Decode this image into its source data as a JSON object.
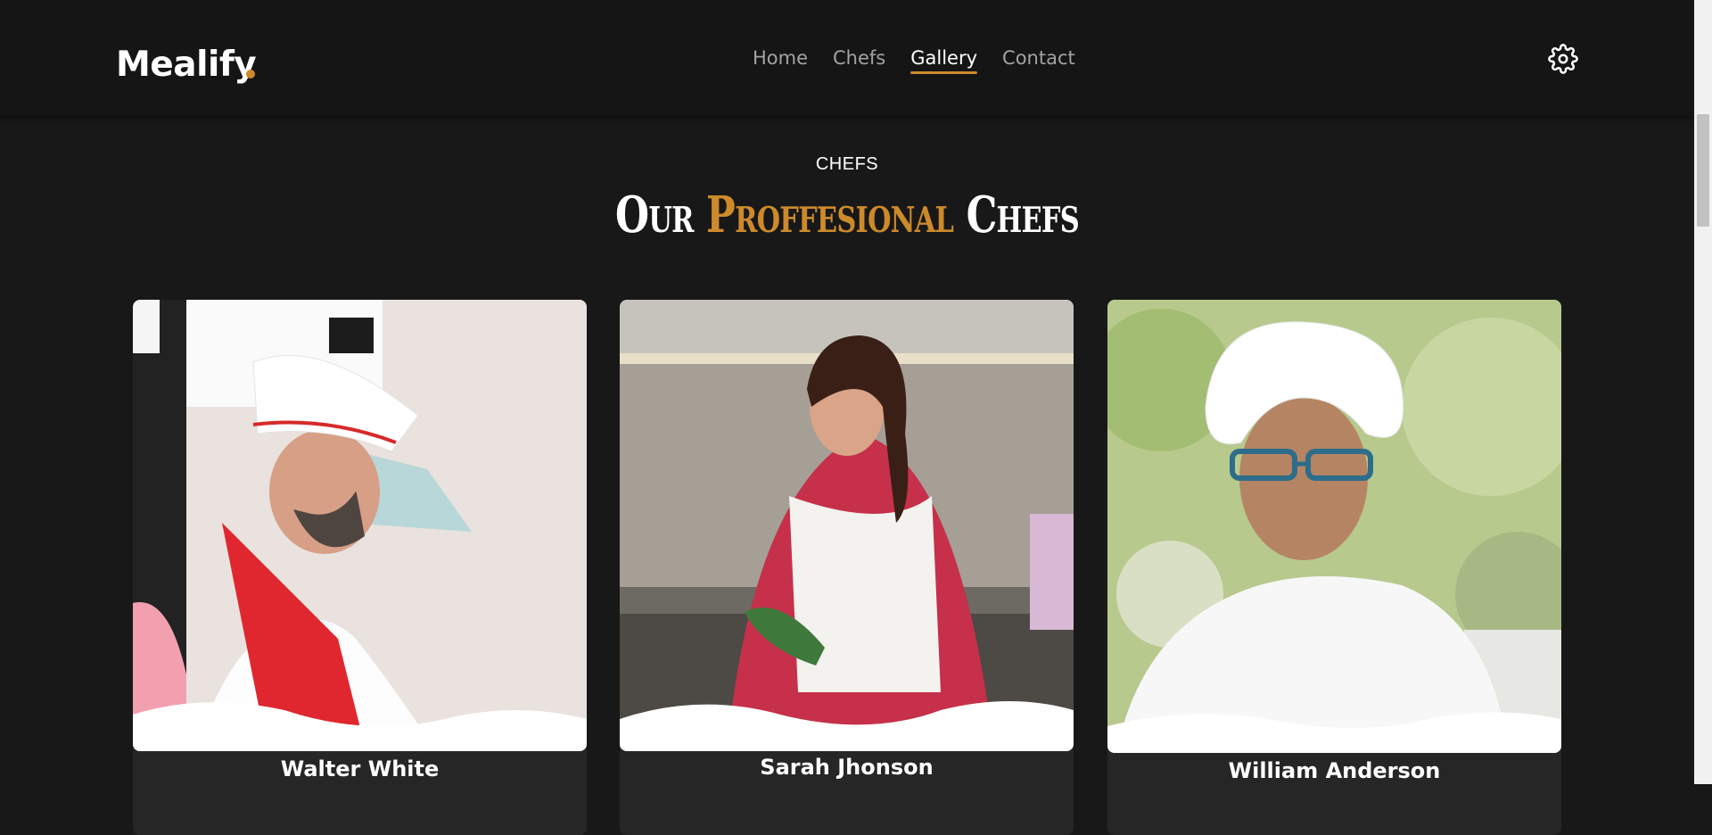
{
  "brand": {
    "name": "Mealify",
    "accent_color": "#cd8a2b"
  },
  "nav": {
    "links": [
      {
        "label": "Home",
        "active": false
      },
      {
        "label": "Chefs",
        "active": false
      },
      {
        "label": "Gallery",
        "active": true
      },
      {
        "label": "Contact",
        "active": false
      }
    ],
    "settings_icon": "gear-icon"
  },
  "section": {
    "eyebrow": "CHEFS",
    "heading_part1": "Our",
    "heading_accent": "Proffesional",
    "heading_part2": "Chefs"
  },
  "chefs": [
    {
      "name": "Walter White"
    },
    {
      "name": "Sarah Jhonson"
    },
    {
      "name": "William Anderson"
    }
  ]
}
